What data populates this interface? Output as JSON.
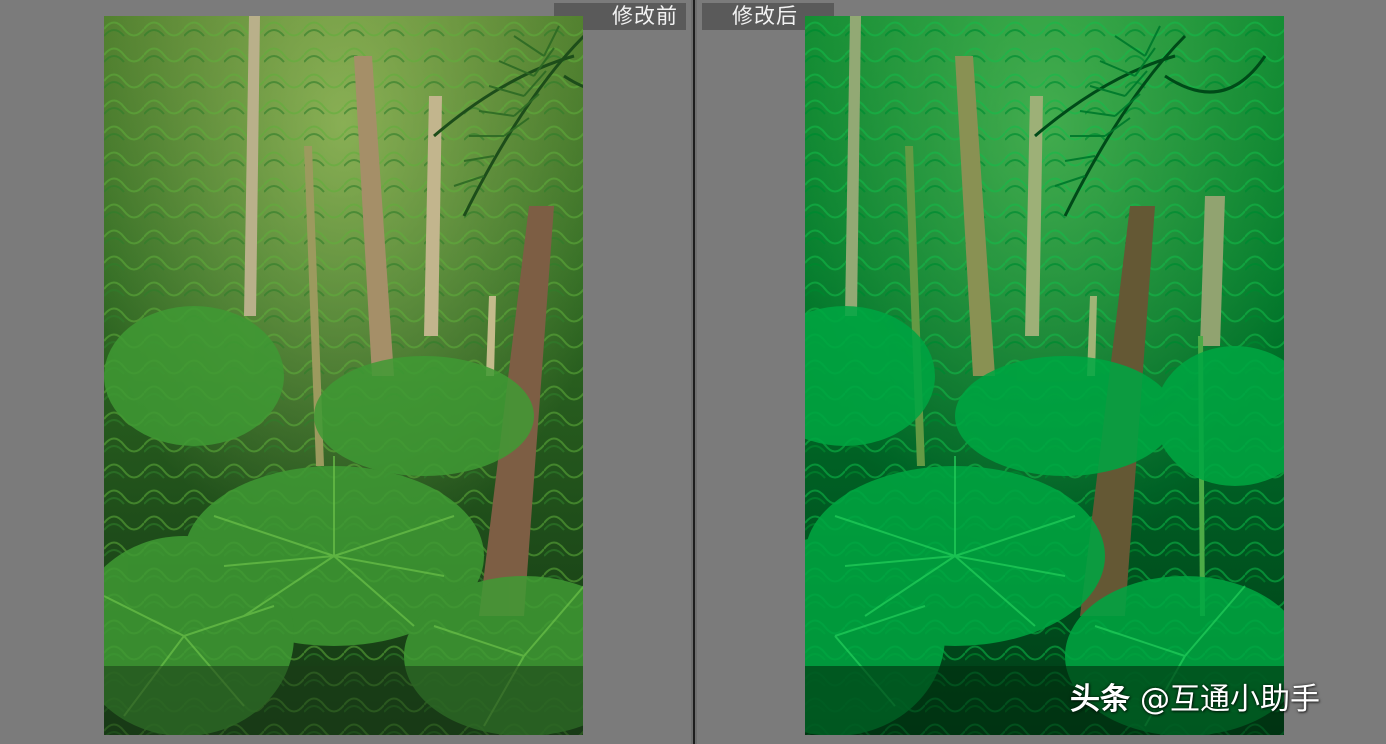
{
  "labels": {
    "before": "修改前",
    "after": "修改后"
  },
  "watermark": {
    "logo_text": "头条",
    "handle": "@互通小助手"
  },
  "colors": {
    "background": "#7b7b7b",
    "label_bg": "#5a5a5a",
    "label_text": "#f2f2f2",
    "divider": "#1e1e1e"
  },
  "images": {
    "before": {
      "description_icon": "image-icon"
    },
    "after": {
      "description_icon": "image-icon"
    }
  }
}
